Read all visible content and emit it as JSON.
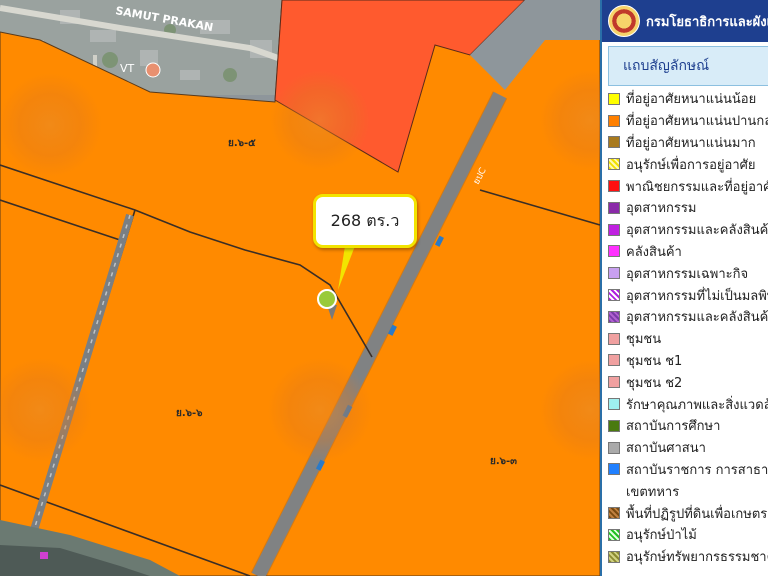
{
  "map": {
    "label_samut_prakan": "SAMUT PRAKAN",
    "label_vt": "VT",
    "label_road_code": "ยปC",
    "zone_labels": [
      "ย.๖-๕",
      "ย.๖-๖",
      "ย.๖-๓"
    ],
    "colors": {
      "orange": "#ff8a00",
      "red_commercial": "#ff5a2e",
      "road_line": "#3a2e26",
      "satellite": "#8e969b"
    }
  },
  "callout": {
    "text": "268 ตร.ว"
  },
  "legend": {
    "header_title": "กรมโยธาธิการและผังเมือง",
    "subheader": "แถบสัญลักษณ์",
    "items": [
      {
        "label": "ที่อยู่อาศัยหนาแน่นน้อย",
        "color": "#ffff00",
        "style": "solid"
      },
      {
        "label": "ที่อยู่อาศัยหนาแน่นปานกลาง",
        "color": "#ff8000",
        "style": "solid"
      },
      {
        "label": "ที่อยู่อาศัยหนาแน่นมาก",
        "color": "#a87a1e",
        "style": "solid"
      },
      {
        "label": "อนุรักษ์เพื่อการอยู่อาศัย",
        "color": "#f0e000",
        "style": "hatch-yellow"
      },
      {
        "label": "พาณิชยกรรมและที่อยู่อาศัย",
        "color": "#ff1010",
        "style": "solid"
      },
      {
        "label": "อุตสาหกรรม",
        "color": "#8a2aa8",
        "style": "solid"
      },
      {
        "label": "อุตสาหกรรมและคลังสินค้า",
        "color": "#c020e0",
        "style": "solid"
      },
      {
        "label": "คลังสินค้า",
        "color": "#ff30ff",
        "style": "solid"
      },
      {
        "label": "อุตสาหกรรมเฉพาะกิจ",
        "color": "#c8a0f0",
        "style": "solid"
      },
      {
        "label": "อุตสาหกรรมที่ไม่เป็นมลพิษ",
        "color": "#b020e0",
        "style": "hatch-purple"
      },
      {
        "label": "อุตสาหกรรมและคลังสินค้า",
        "color": "#7a3aa8",
        "style": "hatch-dpurple"
      },
      {
        "label": "ชุมชน",
        "color": "#f0a0a0",
        "style": "solid"
      },
      {
        "label": "ชุมชน  ช1",
        "color": "#f0a0a0",
        "style": "solid"
      },
      {
        "label": "ชุมชน  ช2",
        "color": "#f0a0a0",
        "style": "solid"
      },
      {
        "label": "รักษาคุณภาพและสิ่งแวดล้อม",
        "color": "#9ff0f0",
        "style": "solid"
      },
      {
        "label": "สถาบันการศึกษา",
        "color": "#4a7a10",
        "style": "solid"
      },
      {
        "label": "สถาบันศาสนา",
        "color": "#aaaaaa",
        "style": "solid"
      },
      {
        "label": "สถาบันราชการ การสาธารณูปโภค",
        "color": "#2080ff",
        "style": "solid"
      },
      {
        "label": "เขตทหาร",
        "color": "#ffffff",
        "style": "empty"
      },
      {
        "label": "พื้นที่ปฏิรูปที่ดินเพื่อเกษตรกรรม",
        "color": "#7a4a10",
        "style": "hatch-brown"
      },
      {
        "label": "อนุรักษ์ป่าไม้",
        "color": "#20c020",
        "style": "hatch-green"
      },
      {
        "label": "อนุรักษ์ทรัพยากรธรรมชาติ",
        "color": "#8a8a30",
        "style": "hatch-olive"
      }
    ]
  }
}
